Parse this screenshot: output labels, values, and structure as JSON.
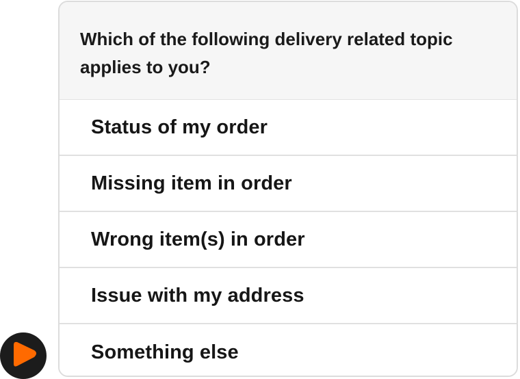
{
  "question": {
    "text": "Which of the following delivery related topic applies to you?"
  },
  "options": [
    {
      "label": "Status of my order"
    },
    {
      "label": "Missing item in order"
    },
    {
      "label": "Wrong item(s) in order"
    },
    {
      "label": "Issue with my address"
    },
    {
      "label": "Something else"
    }
  ],
  "avatar": {
    "icon": "play-icon",
    "accent_color": "#ff6a00",
    "background_color": "#1c1c1c"
  }
}
